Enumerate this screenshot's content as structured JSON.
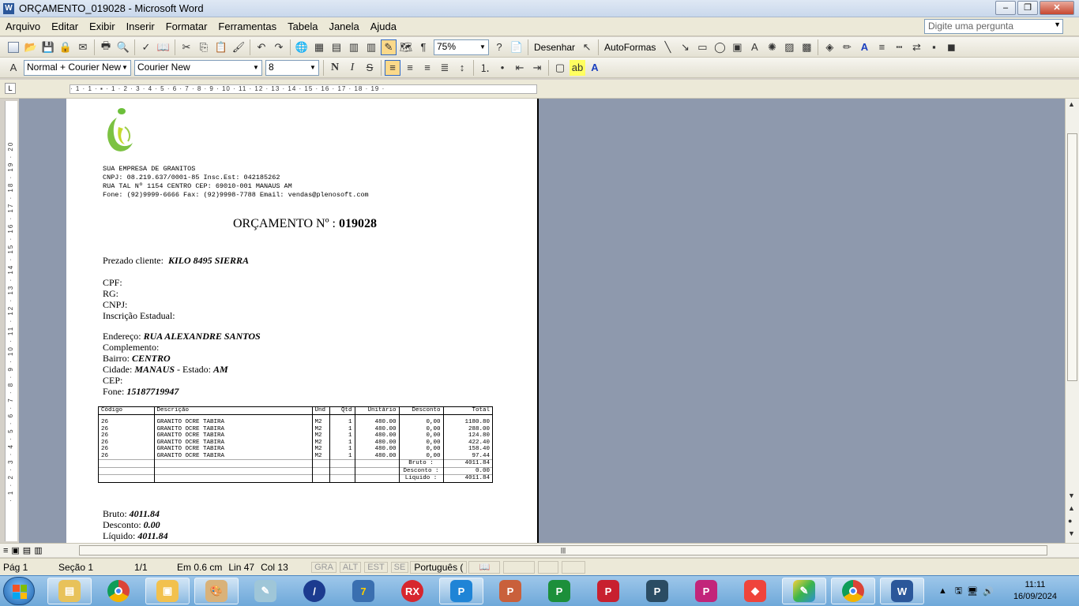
{
  "window": {
    "title": "ORÇAMENTO_019028 - Microsoft Word",
    "min": "–",
    "max": "❐",
    "close": "✕"
  },
  "menu": {
    "items": [
      "Arquivo",
      "Editar",
      "Exibir",
      "Inserir",
      "Formatar",
      "Ferramentas",
      "Tabela",
      "Janela",
      "Ajuda"
    ],
    "ask_placeholder": "Digite uma pergunta"
  },
  "toolbar1": {
    "zoom": "75%",
    "draw_label": "Desenhar",
    "autoshapes_label": "AutoFormas"
  },
  "toolbar2": {
    "style": "Normal + Courier New",
    "font": "Courier New",
    "size": "8"
  },
  "ruler": {
    "h_scale": "· 1 · 1 · ▪ · 1 · 2 · 3 · 4 · 5 · 6 · 7 · 8 · 9 · 10 · 11 · 12 · 13 · 14 · 15 · 16 · 17 · 18 · 19 ·",
    "v_scale": "· 1 · 2 · 3 · 4 · 5 · 6 · 7 · 8 · 9 · 10 · 11 · 12 · 13 · 14 · 15 · 16 · 17 · 18 · 19 · 20"
  },
  "doc": {
    "company": [
      "SUA EMPRESA DE GRANITOS",
      "CNPJ: 08.219.637/0001-85 Insc.Est: 042185262",
      "RUA TAL Nº 1154 CENTRO CEP: 69010-001 MANAUS AM",
      "Fone: (92)9999-6666 Fax: (92)9998-7788 Email: vendas@plenosoft.com"
    ],
    "orc_label": "ORÇAMENTO Nº : ",
    "orc_number": "019028",
    "client_label": "Prezado cliente:",
    "client_name": "KILO 8495 SIERRA",
    "cpf": "CPF:",
    "rg": "RG:",
    "cnpj": "CNPJ:",
    "ie": "Inscrição Estadual:",
    "endereco_label": "Endereço:",
    "endereco": "RUA ALEXANDRE SANTOS",
    "complemento": "Complemento:",
    "bairro_label": "Bairro:",
    "bairro": "CENTRO",
    "cidade_label": "Cidade:",
    "cidade": "MANAUS",
    "estado_label": " - Estado:",
    "estado": "AM",
    "cep": "CEP:",
    "fone_label": "Fone:",
    "fone": "15187719947",
    "table": {
      "headers": [
        "Código",
        "Descrição",
        "Und",
        "Qtd",
        "Unitário",
        "Desconto",
        "Total"
      ],
      "rows": [
        [
          "26",
          "GRANITO OCRE TABIRA",
          "M2",
          "1",
          "480.00",
          "0,00",
          "1180.80"
        ],
        [
          "26",
          "GRANITO OCRE TABIRA",
          "M2",
          "1",
          "480.00",
          "0,00",
          "288.00"
        ],
        [
          "26",
          "GRANITO OCRE TABIRA",
          "M2",
          "1",
          "480.00",
          "0,00",
          "124.80"
        ],
        [
          "26",
          "GRANITO OCRE TABIRA",
          "M2",
          "1",
          "480.00",
          "0,00",
          "422.40"
        ],
        [
          "26",
          "GRANITO OCRE TABIRA",
          "M2",
          "1",
          "480.00",
          "0,00",
          "158.40"
        ],
        [
          "26",
          "GRANITO OCRE TABIRA",
          "M2",
          "1",
          "480.00",
          "0,00",
          "97.44"
        ]
      ],
      "totals": [
        {
          "label": "Bruto    :",
          "value": "4011.84"
        },
        {
          "label": "Desconto :",
          "value": "0.00"
        },
        {
          "label": "Líquido  :",
          "value": "4011.84"
        }
      ]
    },
    "bruto_label": "Bruto:",
    "bruto": "4011.84",
    "desconto_label": "Desconto:",
    "desconto": "0.00",
    "liquido_label": "Líquido:",
    "liquido": "4011.84"
  },
  "status": {
    "page": "Pág 1",
    "section": "Seção  1",
    "pages": "1/1",
    "at": "Em  0.6 cm",
    "line": "Lin  47",
    "col": "Col  13",
    "gra": "GRA",
    "alt": "ALT",
    "est": "EST",
    "se": "SE",
    "lang": "Português ("
  },
  "taskbar": {
    "time": "11:11",
    "date": "16/09/2024",
    "apps": [
      "explorer",
      "chrome",
      "folder",
      "paint",
      "notepad",
      "blue-app",
      "7z",
      "rx",
      "app-blue",
      "app-orange",
      "app-green",
      "app-red",
      "app-teal",
      "app-pink",
      "anydesk",
      "colors",
      "chrome-2",
      "word"
    ]
  },
  "colors": {
    "workspace": "#8e99ad",
    "taskbar": "#6ea8d9",
    "active_button": "#fbd98a"
  }
}
